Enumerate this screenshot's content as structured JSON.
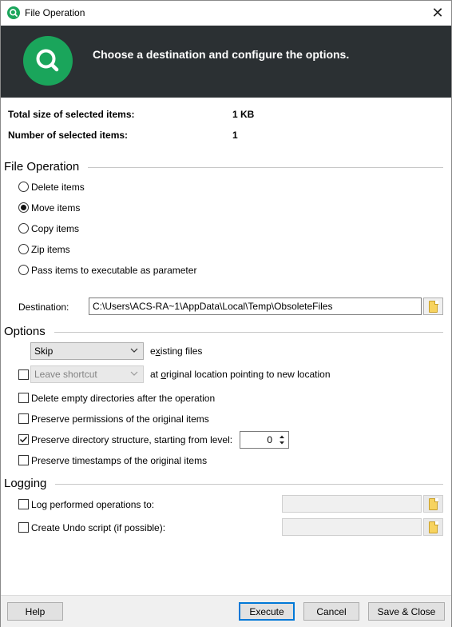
{
  "window": {
    "title": "File Operation",
    "close_symbol": "✕"
  },
  "banner": {
    "icon": "search-icon",
    "text": "Choose a destination and configure the options."
  },
  "summary": {
    "total_size_label": "Total size of selected items:",
    "total_size_value": "1 KB",
    "count_label": "Number of selected items:",
    "count_value": "1"
  },
  "file_operation": {
    "title": "File Operation",
    "options": [
      {
        "label": "Delete items",
        "selected": false
      },
      {
        "label": "Move items",
        "selected": true
      },
      {
        "label": "Copy items",
        "selected": false
      },
      {
        "label": "Zip items",
        "selected": false
      },
      {
        "label": "Pass items to executable as parameter",
        "selected": false
      }
    ],
    "destination_label": "Destination:",
    "destination_value": "C:\\Users\\ACS-RA~1\\AppData\\Local\\Temp\\ObsoleteFiles"
  },
  "options": {
    "title": "Options",
    "existing_select": "Skip",
    "existing_label_pre": "e",
    "existing_label_underlined": "x",
    "existing_label_post": "isting files",
    "shortcut_select": "Leave shortcut",
    "shortcut_checked": false,
    "shortcut_label_pre": "at ",
    "shortcut_label_underlined": "o",
    "shortcut_label_post": "riginal location pointing to new location",
    "delete_empty_label": "Delete empty directories after the operation",
    "delete_empty_checked": false,
    "preserve_permissions_label": "Preserve permissions of the original items",
    "preserve_permissions_checked": false,
    "preserve_structure_label": "Preserve directory structure, starting from level:",
    "preserve_structure_checked": true,
    "level_value": "0",
    "preserve_timestamps_label": "Preserve timestamps of the original items",
    "preserve_timestamps_checked": false
  },
  "logging": {
    "title": "Logging",
    "log_label": "Log performed operations to:",
    "log_checked": false,
    "log_value": "",
    "undo_label": "Create Undo script (if possible):",
    "undo_checked": false,
    "undo_value": ""
  },
  "footer": {
    "help": "Help",
    "execute": "Execute",
    "cancel": "Cancel",
    "save_close": "Save & Close"
  },
  "colors": {
    "accent_green": "#1aa55b",
    "banner_bg": "#2b3033",
    "default_button_border": "#0078d7"
  }
}
